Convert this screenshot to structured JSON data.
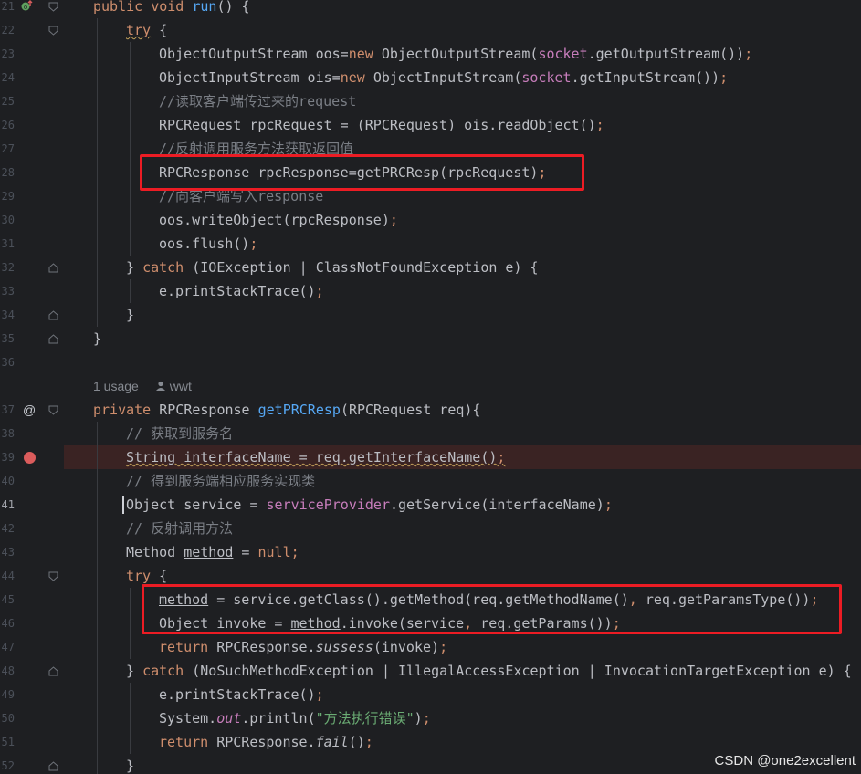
{
  "editor": {
    "lines": [
      {
        "num": "21",
        "tokens": [
          [
            "kw",
            "public "
          ],
          [
            "kw",
            "void "
          ],
          [
            "fn",
            "run"
          ],
          [
            "",
            "() {"
          ]
        ],
        "guides": []
      },
      {
        "num": "22",
        "tokens": [
          [
            "kw wavy",
            "try"
          ],
          [
            "",
            " {"
          ]
        ],
        "guides": [
          1
        ]
      },
      {
        "num": "23",
        "tokens": [
          [
            "",
            "ObjectOutputStream oos="
          ],
          [
            "kw",
            "new "
          ],
          [
            "",
            "ObjectOutputStream("
          ],
          [
            "fld",
            "socket"
          ],
          [
            "",
            ".getOutputStream())"
          ],
          [
            "kw",
            ";"
          ]
        ],
        "guides": [
          1,
          2
        ]
      },
      {
        "num": "24",
        "tokens": [
          [
            "",
            "ObjectInputStream ois="
          ],
          [
            "kw",
            "new "
          ],
          [
            "",
            "ObjectInputStream("
          ],
          [
            "fld",
            "socket"
          ],
          [
            "",
            ".getInputStream())"
          ],
          [
            "kw",
            ";"
          ]
        ],
        "guides": [
          1,
          2
        ]
      },
      {
        "num": "25",
        "tokens": [
          [
            "cm",
            "//读取客户端传过来的request"
          ]
        ],
        "guides": [
          1,
          2
        ]
      },
      {
        "num": "26",
        "tokens": [
          [
            "",
            "RPCRequest rpcRequest = (RPCRequest) ois.readObject()"
          ],
          [
            "kw",
            ";"
          ]
        ],
        "guides": [
          1,
          2
        ]
      },
      {
        "num": "27",
        "tokens": [
          [
            "cm",
            "//反射调用服务方法获取返回值"
          ]
        ],
        "guides": [
          1,
          2
        ]
      },
      {
        "num": "28",
        "tokens": [
          [
            "",
            "RPCResponse rpcResponse=getPRCResp(rpcRequest)"
          ],
          [
            "kw",
            ";"
          ]
        ],
        "guides": [
          1,
          2
        ]
      },
      {
        "num": "29",
        "tokens": [
          [
            "cm",
            "//向客户端写入response"
          ]
        ],
        "guides": [
          1,
          2
        ]
      },
      {
        "num": "30",
        "tokens": [
          [
            "",
            "oos.writeObject(rpcResponse)"
          ],
          [
            "kw",
            ";"
          ]
        ],
        "guides": [
          1,
          2
        ]
      },
      {
        "num": "31",
        "tokens": [
          [
            "",
            "oos.flush()"
          ],
          [
            "kw",
            ";"
          ]
        ],
        "guides": [
          1,
          2
        ]
      },
      {
        "num": "32",
        "tokens": [
          [
            "",
            "} "
          ],
          [
            "kw",
            "catch "
          ],
          [
            "",
            "(IOException | ClassNotFoundException e) {"
          ]
        ],
        "guides": [
          1
        ]
      },
      {
        "num": "33",
        "tokens": [
          [
            "",
            "e.printStackTrace()"
          ],
          [
            "kw",
            ";"
          ]
        ],
        "guides": [
          1,
          2
        ]
      },
      {
        "num": "34",
        "tokens": [
          [
            "",
            "}"
          ]
        ],
        "guides": [
          1
        ]
      },
      {
        "num": "35",
        "tokens": [
          [
            "",
            "}"
          ]
        ],
        "guides": []
      },
      {
        "num": "36",
        "tokens": [],
        "guides": []
      },
      {
        "num": "",
        "hint": true,
        "guides": []
      },
      {
        "num": "37",
        "tokens": [
          [
            "kw",
            "private "
          ],
          [
            "",
            "RPCResponse "
          ],
          [
            "fn",
            "getPRCResp"
          ],
          [
            "",
            "(RPCRequest req){"
          ]
        ],
        "guides": []
      },
      {
        "num": "38",
        "tokens": [
          [
            "cm",
            "// 获取到服务名"
          ]
        ],
        "guides": [
          1
        ]
      },
      {
        "num": "39",
        "tokens": [
          [
            "wavy",
            "String "
          ],
          [
            "wavy ul",
            ""
          ],
          [
            "wavy",
            "interfaceName = req.getInterfaceName()"
          ],
          [
            "kw wavy",
            ";"
          ]
        ],
        "guides": [
          1
        ]
      },
      {
        "num": "40",
        "tokens": [
          [
            "cm",
            "// 得到服务端相应服务实现类"
          ]
        ],
        "guides": [
          1
        ]
      },
      {
        "num": "41",
        "tokens": [
          [
            "",
            "Object service = "
          ],
          [
            "fld",
            "serviceProvider"
          ],
          [
            "",
            ".getService(interfaceName)"
          ],
          [
            "kw",
            ";"
          ]
        ],
        "guides": [
          1
        ]
      },
      {
        "num": "42",
        "tokens": [
          [
            "cm",
            "// 反射调用方法"
          ]
        ],
        "guides": [
          1
        ]
      },
      {
        "num": "43",
        "tokens": [
          [
            "",
            "Method "
          ],
          [
            "ul",
            "method"
          ],
          [
            "",
            " = "
          ],
          [
            "kw",
            "null"
          ],
          [
            "kw",
            ";"
          ]
        ],
        "guides": [
          1
        ]
      },
      {
        "num": "44",
        "tokens": [
          [
            "kw",
            "try"
          ],
          [
            "",
            " {"
          ]
        ],
        "guides": [
          1
        ]
      },
      {
        "num": "45",
        "tokens": [
          [
            "ul",
            "method"
          ],
          [
            "",
            " = service.getClass().getMethod(req.getMethodName()"
          ],
          [
            "kw",
            ", "
          ],
          [
            "",
            "req.getParamsType())"
          ],
          [
            "kw",
            ";"
          ]
        ],
        "guides": [
          1,
          2
        ]
      },
      {
        "num": "46",
        "tokens": [
          [
            "",
            "Object invoke = "
          ],
          [
            "ul",
            "method"
          ],
          [
            "",
            ".invoke(service"
          ],
          [
            "kw",
            ", "
          ],
          [
            "",
            "req.getParams())"
          ],
          [
            "kw",
            ";"
          ]
        ],
        "guides": [
          1,
          2
        ]
      },
      {
        "num": "47",
        "tokens": [
          [
            "kw",
            "return "
          ],
          [
            "",
            "RPCResponse."
          ],
          [
            "it",
            "sussess"
          ],
          [
            "",
            "(invoke)"
          ],
          [
            "kw",
            ";"
          ]
        ],
        "guides": [
          1,
          2
        ]
      },
      {
        "num": "48",
        "tokens": [
          [
            "",
            "} "
          ],
          [
            "kw",
            "catch "
          ],
          [
            "",
            "(NoSuchMethodException | IllegalAccessException | InvocationTargetException e) {"
          ]
        ],
        "guides": [
          1
        ]
      },
      {
        "num": "49",
        "tokens": [
          [
            "",
            "e.printStackTrace()"
          ],
          [
            "kw",
            ";"
          ]
        ],
        "guides": [
          1,
          2
        ]
      },
      {
        "num": "50",
        "tokens": [
          [
            "",
            "System."
          ],
          [
            "fld it",
            "out"
          ],
          [
            "",
            ".println("
          ],
          [
            "str",
            "\"方法执行错误\""
          ],
          [
            "",
            ")"
          ],
          [
            "kw",
            ";"
          ]
        ],
        "guides": [
          1,
          2
        ]
      },
      {
        "num": "51",
        "tokens": [
          [
            "kw",
            "return "
          ],
          [
            "",
            "RPCResponse."
          ],
          [
            "it",
            "fail"
          ],
          [
            "",
            "()"
          ],
          [
            "kw",
            ";"
          ]
        ],
        "guides": [
          1,
          2
        ]
      },
      {
        "num": "52",
        "tokens": [
          [
            "",
            "}"
          ]
        ],
        "guides": [
          1
        ]
      }
    ],
    "usage_hint": {
      "usages": "1 usage",
      "author": "wwt"
    },
    "current_line": "41",
    "breakpoint_line": "39"
  },
  "colors": {
    "background": "#1e1f22",
    "keyword": "#cf8e6d",
    "function": "#56a8f5",
    "field": "#c77dbb",
    "string": "#6aab73",
    "comment": "#7a7e85",
    "highlight_box": "#ec1c24",
    "breakpoint": "#db5c5c"
  },
  "watermark": "CSDN @one2excellent"
}
